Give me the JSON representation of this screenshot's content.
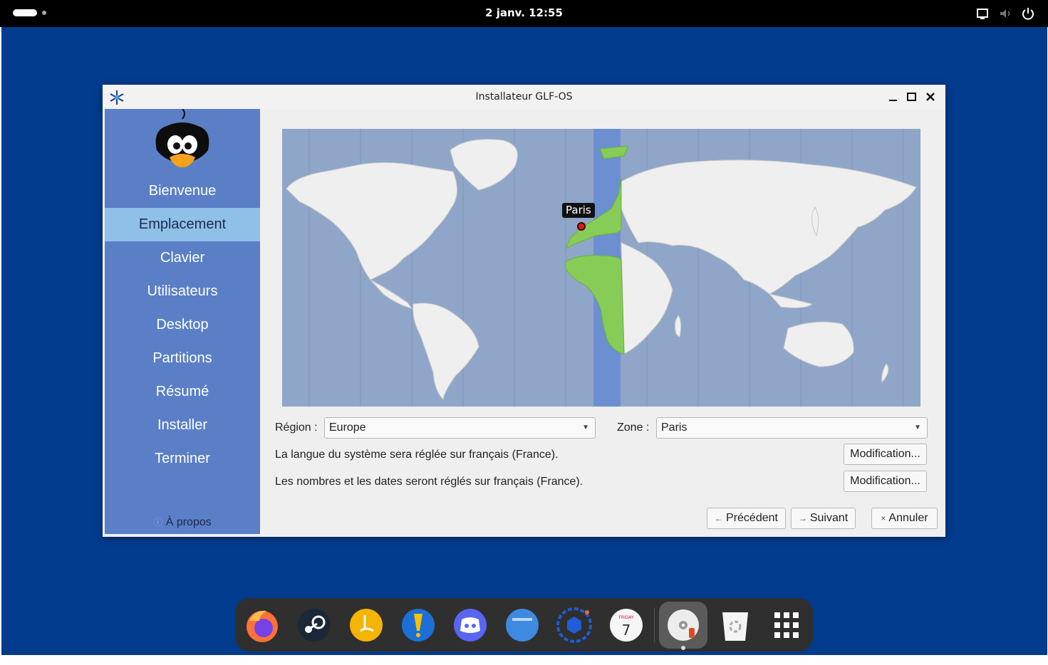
{
  "topbar": {
    "clock": "2 janv. 12:55",
    "icons": [
      "screen-icon",
      "volume-muted-icon",
      "power-icon"
    ]
  },
  "window": {
    "title": "Installateur GLF-OS",
    "controls": [
      "minimize-icon",
      "maximize-icon",
      "close-icon"
    ]
  },
  "sidebar": {
    "items": [
      {
        "label": "Bienvenue"
      },
      {
        "label": "Emplacement",
        "active": true
      },
      {
        "label": "Clavier"
      },
      {
        "label": "Utilisateurs"
      },
      {
        "label": "Desktop"
      },
      {
        "label": "Partitions"
      },
      {
        "label": "Résumé"
      },
      {
        "label": "Installer"
      },
      {
        "label": "Terminer"
      }
    ],
    "about_icon": "ⓘ",
    "about_label": "À propos"
  },
  "map": {
    "pin_label": "Paris",
    "highlight_color": "#86cc57",
    "band_color": "#6b8fd0"
  },
  "location": {
    "region_label": "Région :",
    "region_value": "Europe",
    "zone_label": "Zone :",
    "zone_value": "Paris",
    "language_text": "La langue du système sera réglée sur français (France).",
    "numbers_text": "Les nombres et les dates seront réglés sur français (France).",
    "modify_label": "Modification..."
  },
  "footer": {
    "prev_label": "Précédent",
    "next_label": "Suivant",
    "cancel_label": "Annuler"
  },
  "dock": {
    "apps": [
      "firefox-icon",
      "steam-icon",
      "lutris-icon",
      "heroic-icon",
      "discord-icon",
      "files-icon",
      "virtualbox-icon",
      "calendar-icon",
      "installer-disk-icon",
      "trash-icon",
      "app-grid-icon"
    ],
    "calendar_day": "FRIDAY",
    "calendar_date": "7"
  }
}
